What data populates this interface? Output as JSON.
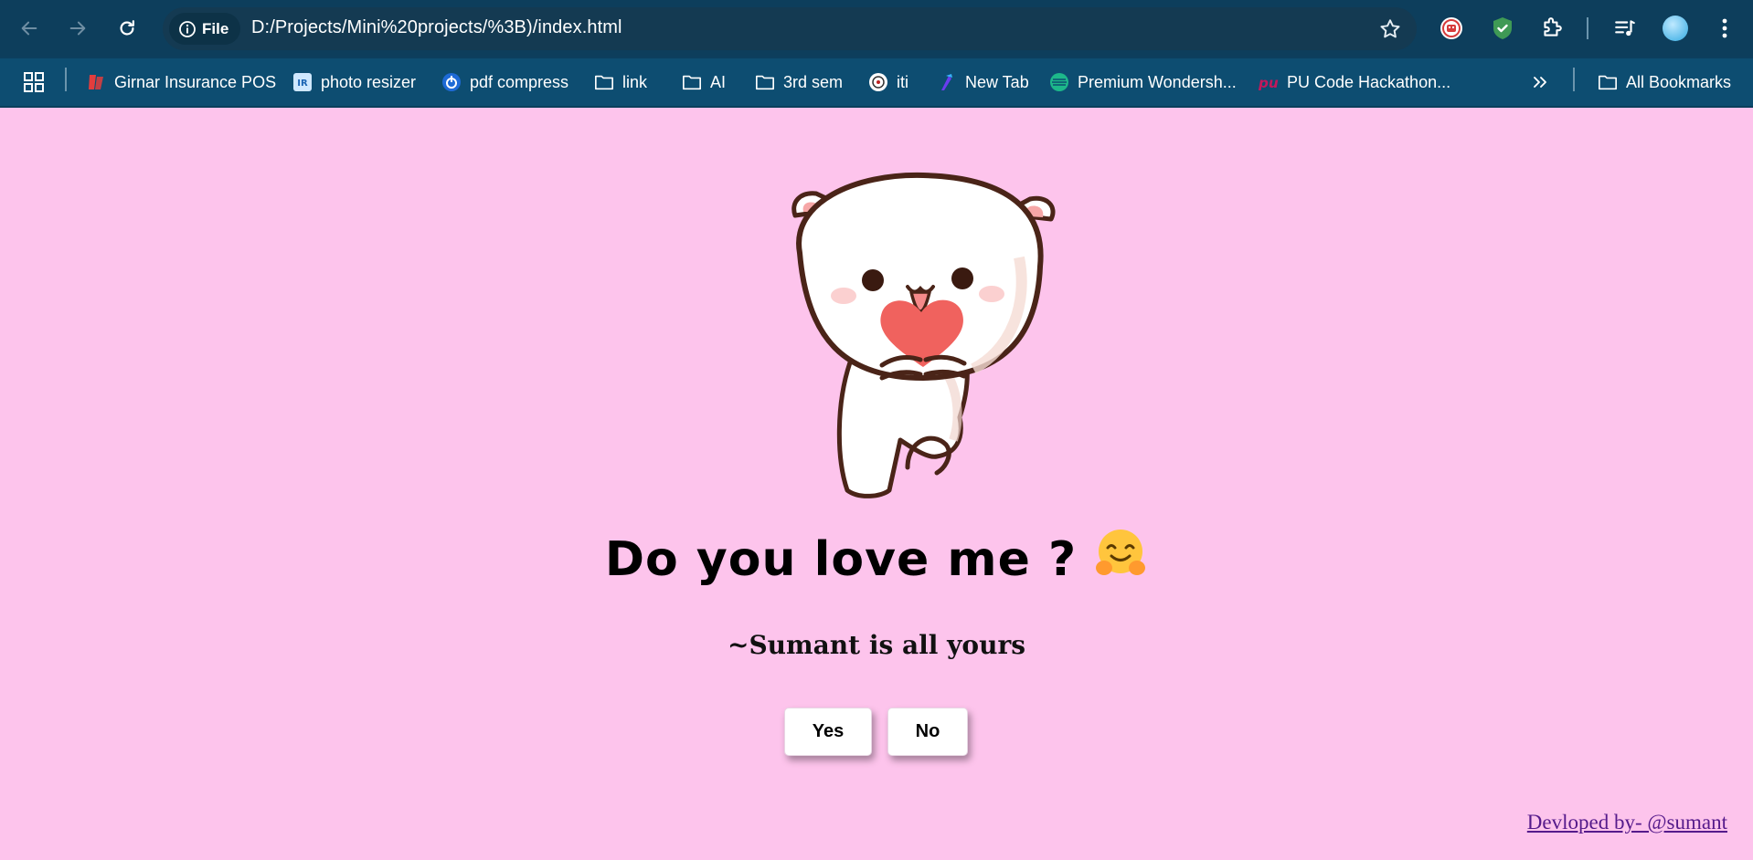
{
  "browser": {
    "omnibox": {
      "chip_label": "File",
      "url": "D:/Projects/Mini%20projects/%3B)/index.html"
    },
    "bookmarks": [
      {
        "label": "Girnar Insurance POS",
        "icon": "girnar-icon"
      },
      {
        "label": "photo resizer",
        "icon": "photo-resizer-icon"
      },
      {
        "label": "pdf compress",
        "icon": "pdf-compress-icon"
      },
      {
        "label": "link",
        "icon": "folder-icon"
      },
      {
        "label": "AI",
        "icon": "folder-icon"
      },
      {
        "label": "3rd sem",
        "icon": "folder-icon"
      },
      {
        "label": "iti",
        "icon": "iti-icon"
      },
      {
        "label": "New Tab",
        "icon": "new-tab-icon"
      },
      {
        "label": "Premium Wondersh...",
        "icon": "wondershare-icon"
      },
      {
        "label": "PU Code Hackathon...",
        "icon": "pu-code-icon"
      }
    ],
    "all_bookmarks_label": "All Bookmarks"
  },
  "page": {
    "question": "Do you love me ?",
    "subtitle": "~Sumant is all yours",
    "yes_label": "Yes",
    "no_label": "No",
    "footer": "Devloped by- @sumant"
  },
  "colors": {
    "page_background": "#fdc4ec",
    "toolbar": "#0d3e5c",
    "bookmarks_bar": "#0d4d71",
    "link": "#551a8b"
  }
}
